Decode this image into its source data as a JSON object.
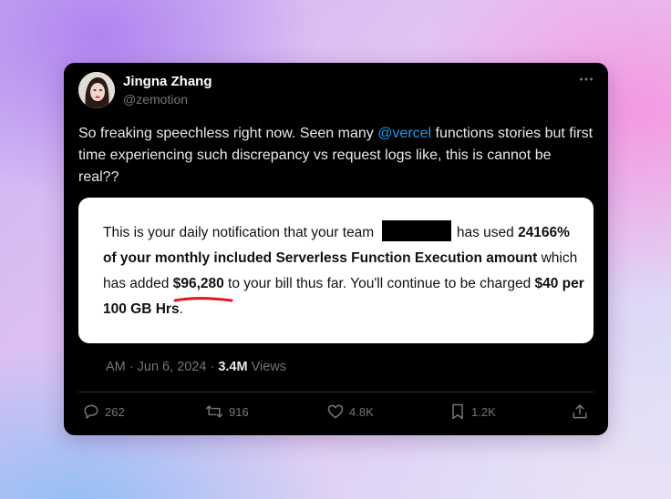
{
  "tweet": {
    "author_name": "Jingna Zhang",
    "author_handle": "@zemotion",
    "text_before": "So freaking speechless right now. Seen many ",
    "mention": "@vercel",
    "text_after": " functions stories but first time experiencing such discrepancy vs request logs like, this is cannot be real??",
    "timestamp": "AM · Jun 6, 2024 · ",
    "views_count": "3.4M",
    "views_label": " Views"
  },
  "notification": {
    "p1": "This is your daily notification that your team ",
    "p2": " has used ",
    "p3_bold": "24166% of your monthly included Serverless Function Execution amount",
    "p4": " which has added ",
    "p5_bold": "$96,280",
    "p6": " to your bill thus far. You'll continue to be charged ",
    "p7_bold": "$40 per 100 GB Hrs",
    "p8": "."
  },
  "actions": {
    "replies": "262",
    "retweets": "916",
    "likes": "4.8K",
    "bookmarks": "1.2K"
  },
  "icons": [
    "more-icon",
    "reply-icon",
    "retweet-icon",
    "like-icon",
    "bookmark-icon",
    "share-icon"
  ],
  "colors": {
    "card_bg": "#000000",
    "text": "#e7e9ea",
    "muted": "#71767b",
    "link": "#1d9bf0",
    "underline": "#e3141b"
  }
}
